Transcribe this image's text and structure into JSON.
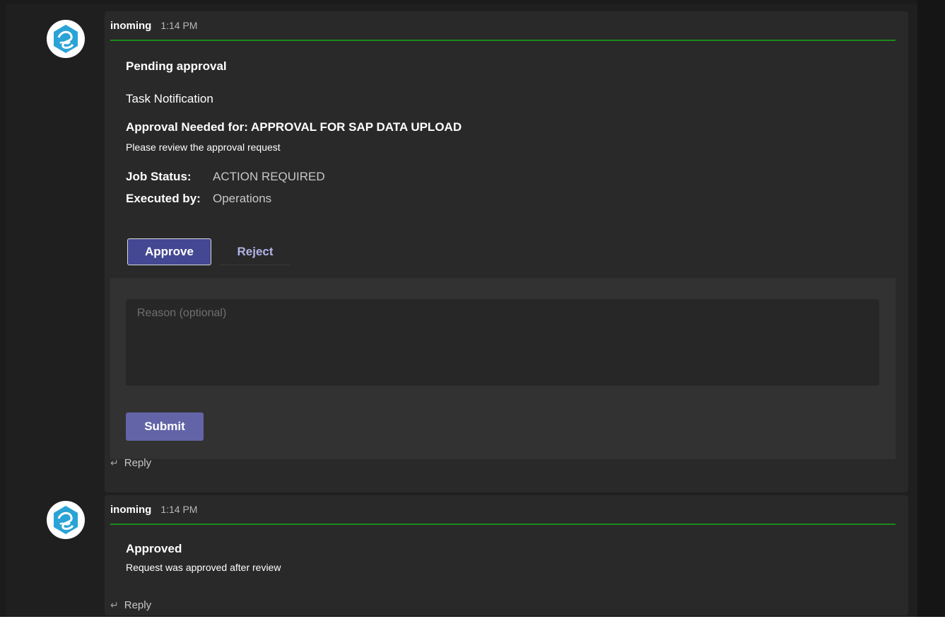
{
  "messages": [
    {
      "sender": "inoming",
      "time": "1:14 PM",
      "card": {
        "title": "Pending approval",
        "subtitle": "Task Notification",
        "approval_heading": "Approval Needed for: APPROVAL FOR SAP DATA UPLOAD",
        "approval_note": "Please review the approval request",
        "fields": [
          {
            "label": "Job Status:",
            "value": "ACTION REQUIRED"
          },
          {
            "label": "Executed by:",
            "value": "Operations"
          }
        ],
        "approve_label": "Approve",
        "reject_label": "Reject",
        "reason_placeholder": "Reason (optional)",
        "submit_label": "Submit"
      },
      "reply_label": "Reply"
    },
    {
      "sender": "inoming",
      "time": "1:14 PM",
      "card": {
        "title": "Approved",
        "note": "Request was approved after review"
      },
      "reply_label": "Reply"
    }
  ],
  "icons": {
    "avatar": "bot-avatar-icon",
    "reply": "reply-arrow-icon"
  },
  "colors": {
    "accent_green": "#1c8a1c",
    "approve_bg": "#444791",
    "submit_bg": "#6264a7",
    "reject_text": "#b2b4e8"
  }
}
